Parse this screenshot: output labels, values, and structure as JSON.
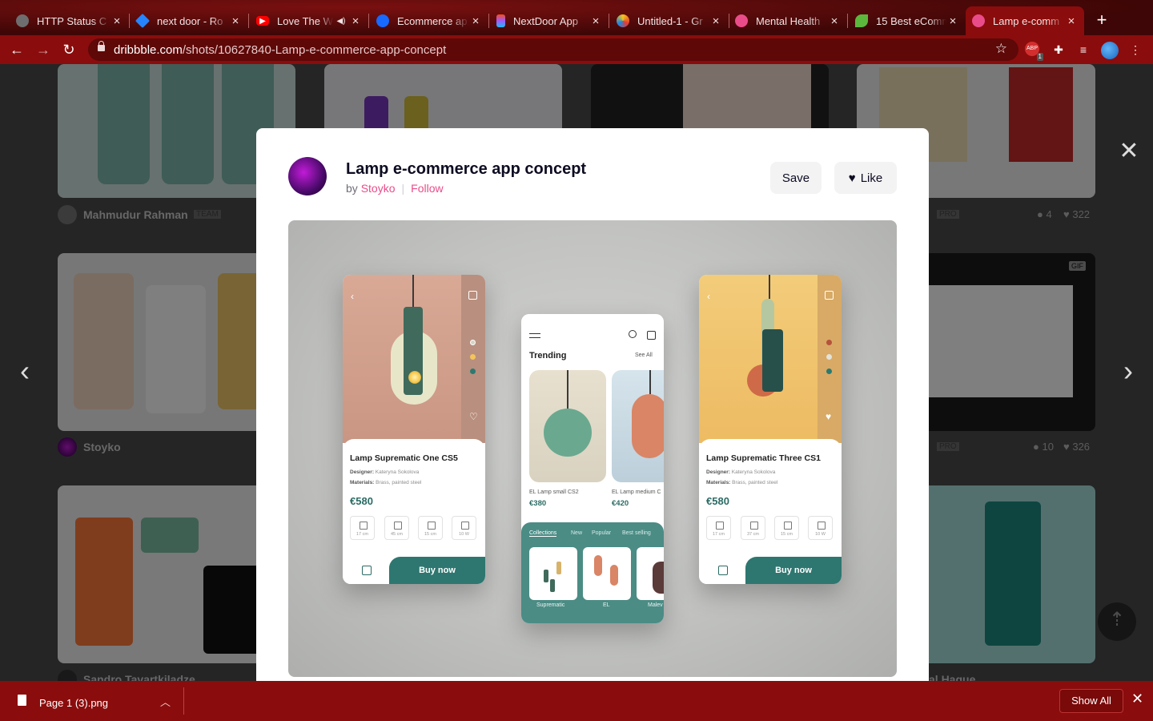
{
  "browser": {
    "tabs": [
      {
        "title": "HTTP Status C",
        "icon": "github-icon",
        "icon_color": "#6e6e6e"
      },
      {
        "title": "next door - Ro",
        "icon": "jira-icon",
        "icon_color": "#2684ff"
      },
      {
        "title": "Love The W",
        "icon": "youtube-icon",
        "icon_color": "#ff0000"
      },
      {
        "title": "Ecommerce ap",
        "icon": "behance-icon",
        "icon_color": "#1769ff"
      },
      {
        "title": "NextDoor App",
        "icon": "figma-icon",
        "icon_color": "#f24e1e"
      },
      {
        "title": "Untitled-1 - Gr",
        "icon": "gradient-icon",
        "icon_color": "#f5c518"
      },
      {
        "title": "Mental Health",
        "icon": "dribbble-icon",
        "icon_color": "#ea4c89"
      },
      {
        "title": "15 Best eComm",
        "icon": "leaf-icon",
        "icon_color": "#5bb83c"
      },
      {
        "title": "Lamp e-comm",
        "icon": "dribbble-icon",
        "icon_color": "#ea4c89"
      }
    ],
    "url_domain": "dribbble.com",
    "url_path": "/shots/10627840-Lamp-e-commerce-app-concept",
    "ext_badge": "1"
  },
  "background": {
    "authors": [
      "Mahmudur Rahman",
      "Stoyko",
      "Sandro Tavartkiladze",
      "al Hague"
    ],
    "team_badge": "TEAM",
    "pro_badge": "PRO",
    "gif_badge": "GIF",
    "stats": [
      {
        "comments": "4",
        "likes": "322"
      },
      {
        "comments": "10",
        "likes": "326"
      }
    ]
  },
  "shot": {
    "title": "Lamp e-commerce app concept",
    "by_label": "by",
    "author": "Stoyko",
    "follow_label": "Follow",
    "save_label": "Save",
    "like_label": "Like"
  },
  "mockup": {
    "left_phone": {
      "name": "Lamp Suprematic One CS5",
      "designer_label": "Designer:",
      "designer": "Kateryna Sokolova",
      "materials_label": "Materials:",
      "materials": "Brass, painted steel",
      "price": "€580",
      "specs": [
        "17 cm",
        "45 cm",
        "15 cm",
        "10 W"
      ],
      "buy_label": "Buy now"
    },
    "middle_phone": {
      "trending": "Trending",
      "see_all": "See All",
      "items": [
        {
          "name": "EL Lamp small CS2",
          "price": "€380"
        },
        {
          "name": "EL Lamp medium C",
          "price": "€420"
        }
      ],
      "collection_tabs": [
        "Collections",
        "New",
        "Popular",
        "Best selling"
      ],
      "collections": [
        "Suprematic",
        "EL",
        "Malev"
      ]
    },
    "right_phone": {
      "name": "Lamp Suprematic Three CS1",
      "designer_label": "Designer:",
      "designer": "Kateryna Sokolova",
      "materials_label": "Materials:",
      "materials": "Brass, painted steel",
      "price": "€580",
      "specs": [
        "17 cm",
        "37 cm",
        "15 cm",
        "10 W"
      ],
      "buy_label": "Buy now"
    }
  },
  "downloads": {
    "file": "Page 1 (3).png",
    "show_all": "Show All"
  }
}
